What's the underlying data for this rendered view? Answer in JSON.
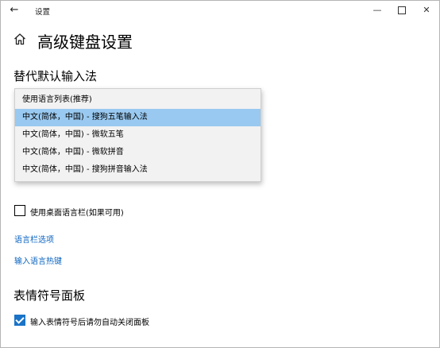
{
  "window": {
    "title": "设置",
    "back_icon": "back-arrow-icon",
    "minimize_icon": "minimize-icon",
    "maximize_icon": "maximize-icon",
    "close_icon": "close-icon"
  },
  "header": {
    "home_icon": "home-icon",
    "title": "高级键盘设置"
  },
  "override_section": {
    "title": "替代默认输入法",
    "dropdown": {
      "options": [
        "使用语言列表(推荐)",
        "中文(简体，中国) - 搜狗五笔输入法",
        "中文(简体，中国) - 微软五笔",
        "中文(简体，中国) - 微软拼音",
        "中文(简体，中国) - 搜狗拼音输入法"
      ],
      "highlighted_index": 1
    }
  },
  "options": {
    "desktop_language_bar": {
      "label": "使用桌面语言栏(如果可用)",
      "checked": false
    }
  },
  "links": {
    "language_bar_options": "语言栏选项",
    "input_language_hotkeys": "输入语言热键"
  },
  "emoji_section": {
    "title": "表情符号面板",
    "auto_close": {
      "label": "输入表情符号后请勿自动关闭面板",
      "checked": true
    }
  },
  "colors": {
    "accent": "#1a73c7",
    "link": "#0b64c0",
    "highlight": "#99c9f0"
  }
}
